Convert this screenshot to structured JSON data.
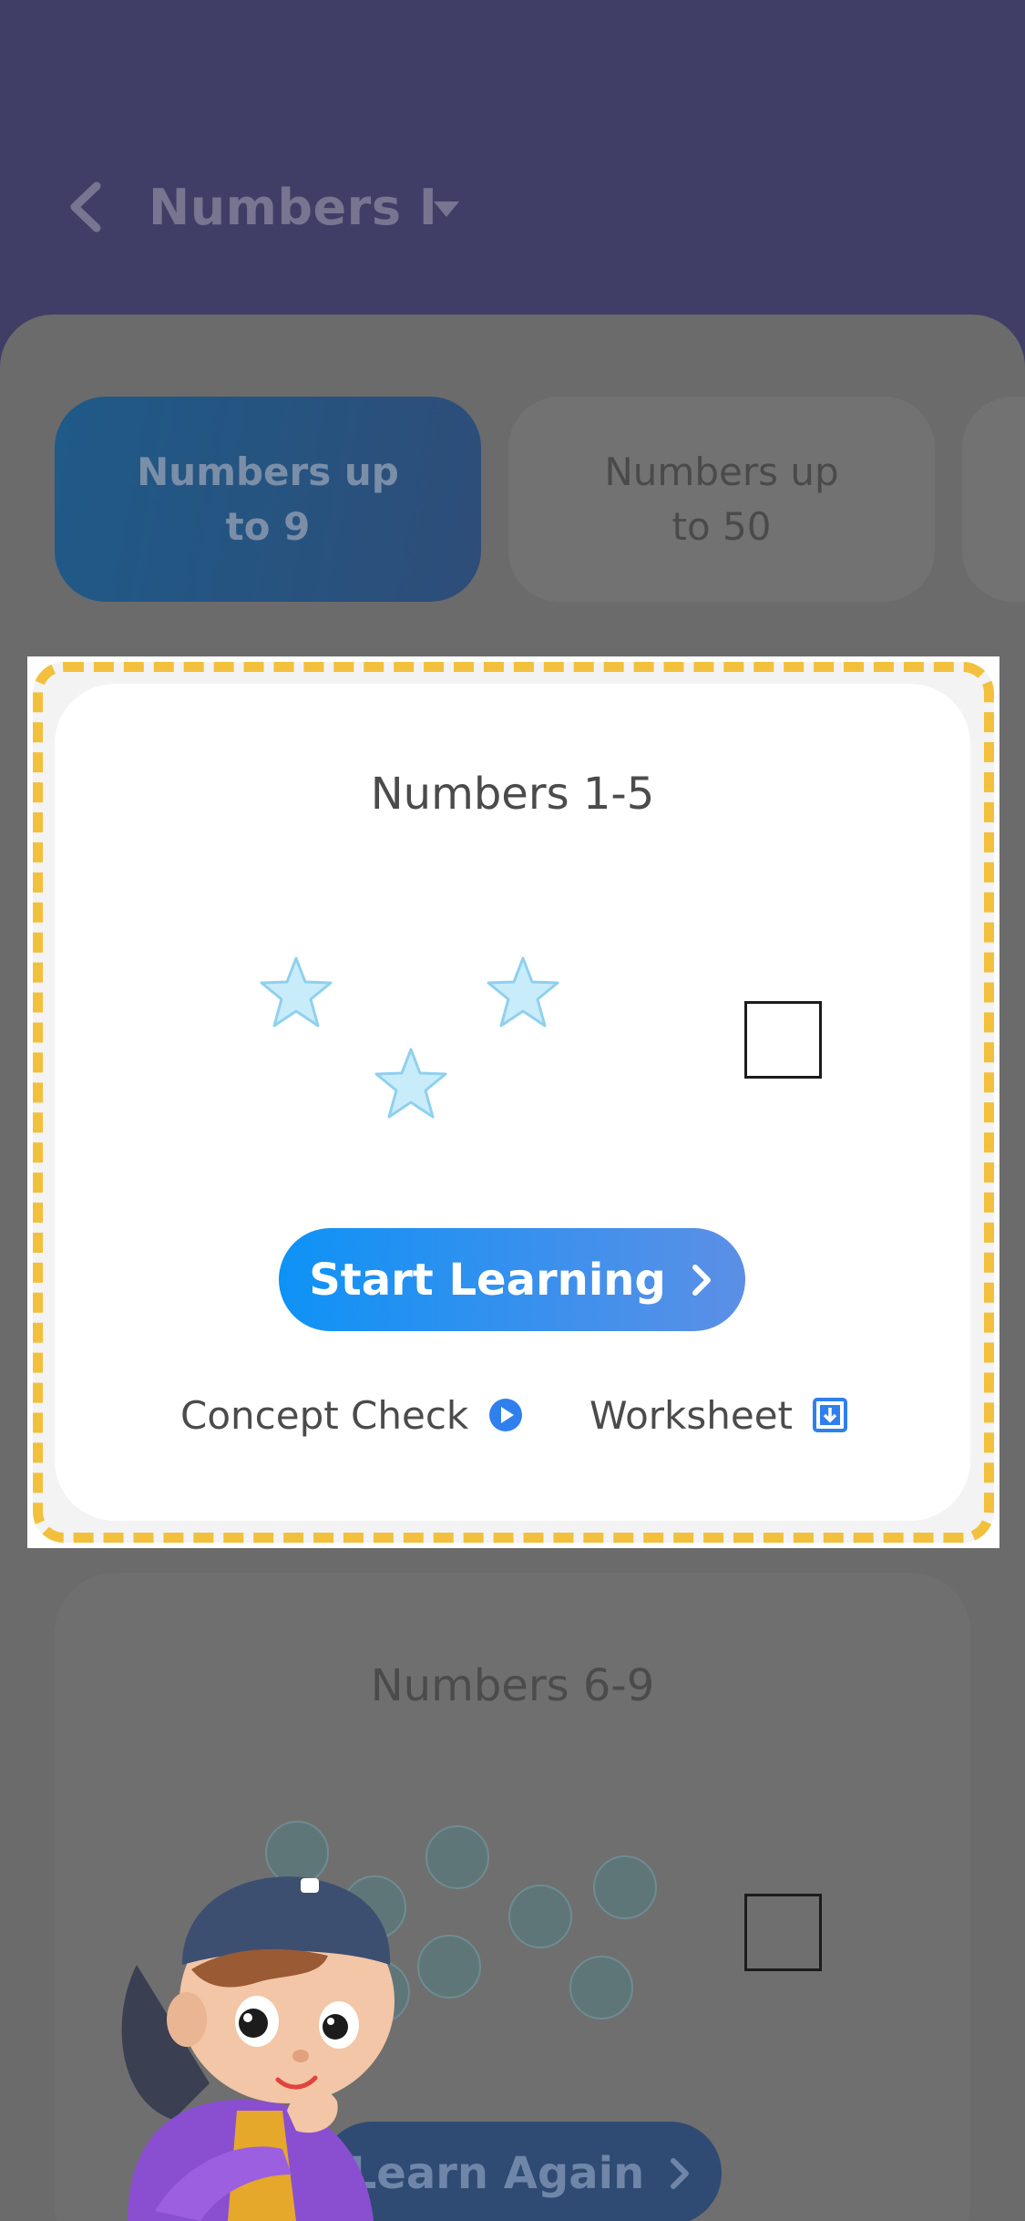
{
  "header": {
    "title": "Numbers I",
    "back_icon": "chevron-left-icon",
    "dropdown_icon": "caret-down-icon",
    "background": "#403e66"
  },
  "tabs": [
    {
      "label": "Numbers up\nto 9",
      "active": true
    },
    {
      "label": "Numbers up\nto 50",
      "active": false
    }
  ],
  "lesson_card": {
    "title": "Numbers 1-5",
    "stars_shown": 3,
    "start_button_label": "Start Learning",
    "links": {
      "concept_check": "Concept Check",
      "worksheet": "Worksheet"
    },
    "highlight_color": "#f2c03c"
  },
  "second_card": {
    "title": "Numbers 6-9",
    "dots_shown": 8,
    "learn_again_label": "Learn Again"
  },
  "colors": {
    "accent": "#0e92f6",
    "overlay": "#6b6b6b"
  }
}
